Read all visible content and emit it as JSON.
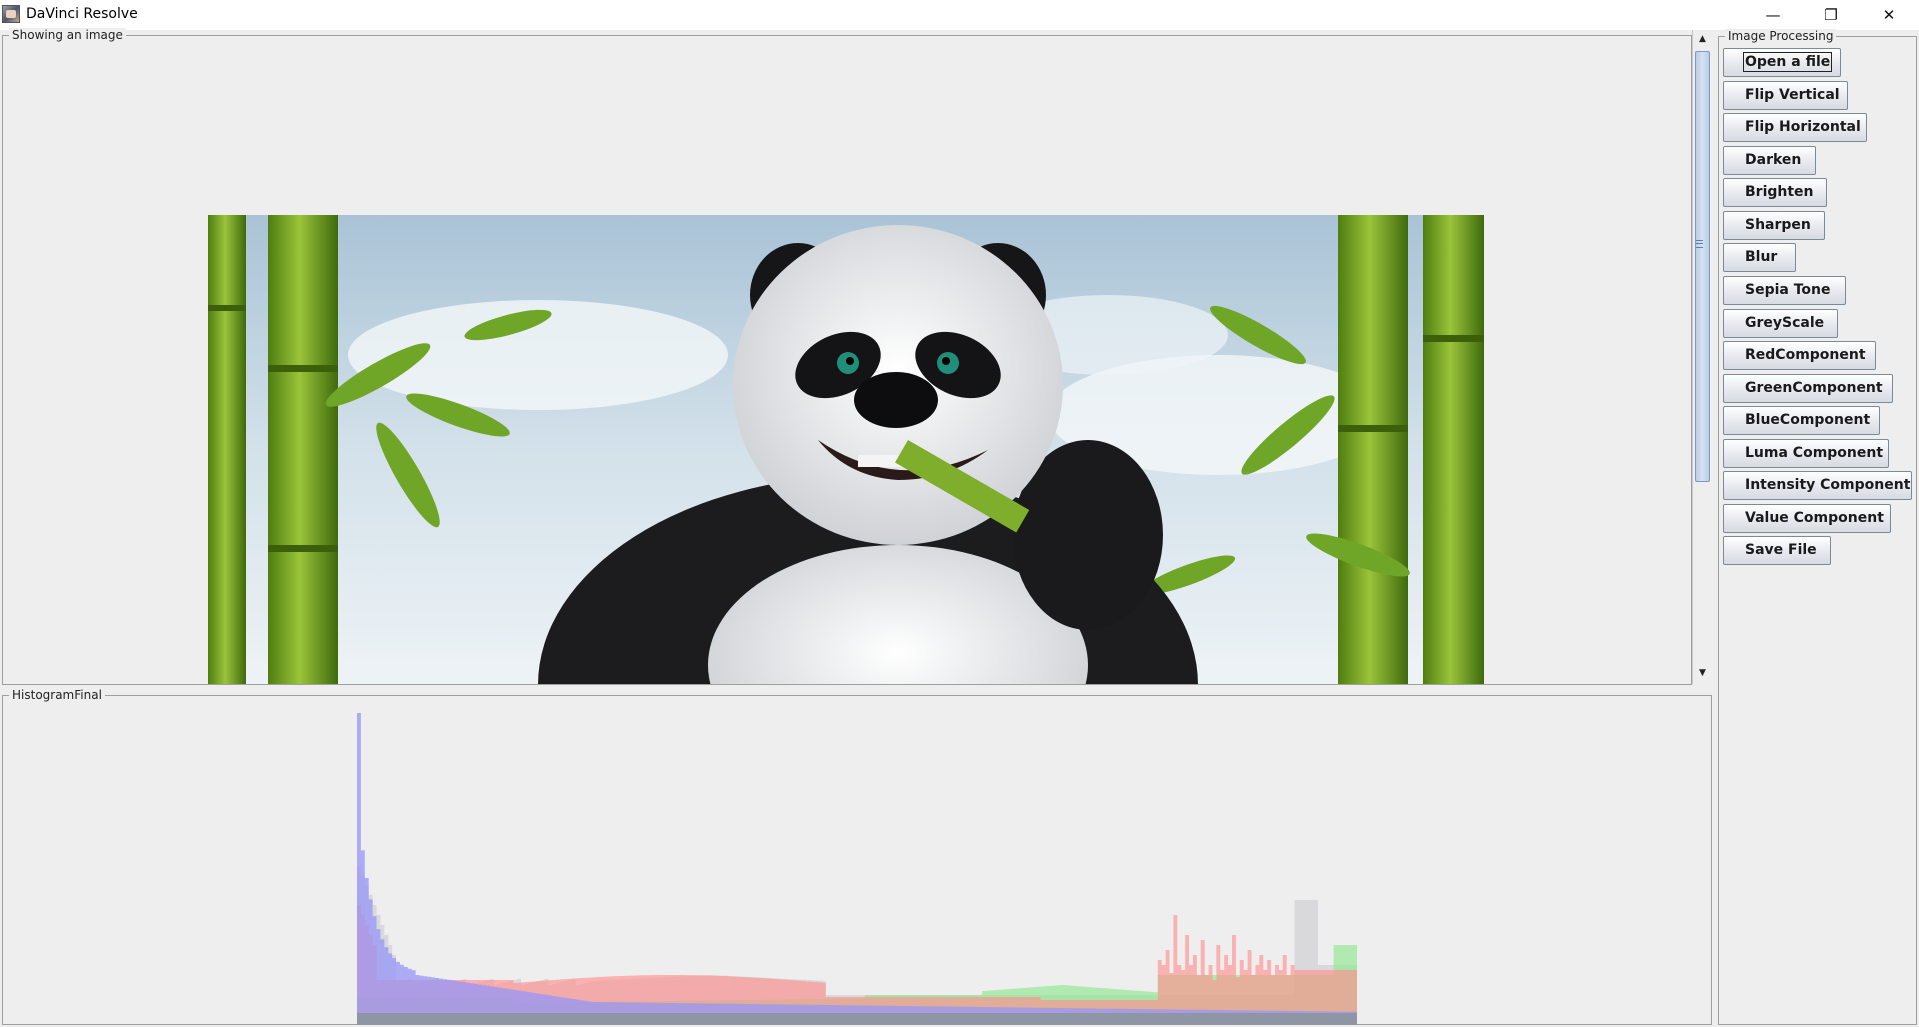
{
  "window": {
    "title": "DaVinci Resolve",
    "controls": {
      "minimize": "—",
      "restore": "❐",
      "close": "✕"
    }
  },
  "image_panel": {
    "label": "Showing an image"
  },
  "histogram_panel": {
    "label": "HistogramFinal",
    "channel_colors": {
      "red": "#ff9090",
      "green": "#90e890",
      "blue": "#9696f8",
      "grey": "#c8c8cc"
    }
  },
  "processing_panel": {
    "label": "Image Processing",
    "buttons": [
      {
        "label": "Open a file"
      },
      {
        "label": "Flip Vertical"
      },
      {
        "label": "Flip Horizontal"
      },
      {
        "label": "Darken"
      },
      {
        "label": "Brighten"
      },
      {
        "label": "Sharpen"
      },
      {
        "label": "Blur"
      },
      {
        "label": "Sepia Tone"
      },
      {
        "label": "GreyScale"
      },
      {
        "label": "RedComponent"
      },
      {
        "label": "GreenComponent"
      },
      {
        "label": "BlueComponent"
      },
      {
        "label": "Luma Component"
      },
      {
        "label": "Intensity Component"
      },
      {
        "label": "Value Component"
      },
      {
        "label": "Save File"
      }
    ]
  }
}
